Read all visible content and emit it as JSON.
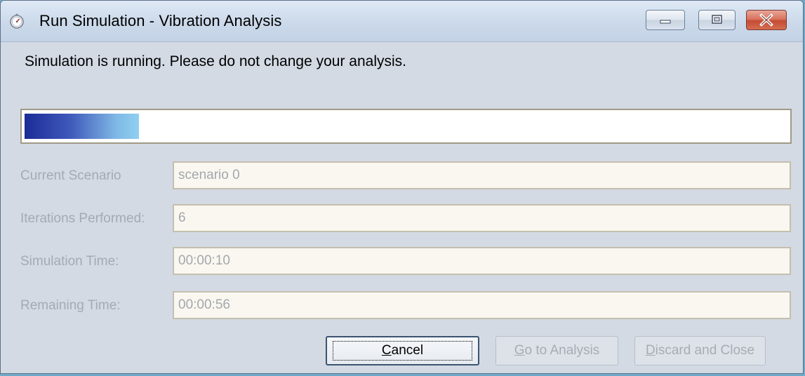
{
  "window": {
    "title": "Run Simulation - Vibration Analysis",
    "icon": "stopwatch-icon",
    "controls": {
      "minimize_icon": "minimize-icon",
      "maximize_icon": "maximize-icon",
      "close_icon": "close-icon"
    }
  },
  "status_message": "Simulation is running. Please do not change your analysis.",
  "progress": {
    "fraction": 0.15
  },
  "fields": [
    {
      "label": "Current Scenario",
      "value": "scenario 0"
    },
    {
      "label": "Iterations Performed:",
      "value": "6"
    },
    {
      "label": "Simulation Time:",
      "value": "00:00:10"
    },
    {
      "label": "Remaining Time:",
      "value": "00:00:56"
    }
  ],
  "buttons": {
    "cancel": {
      "label_underlined": "C",
      "label_rest": "ancel"
    },
    "go_to_analysis": {
      "label_underlined": "G",
      "label_rest": "o to Analysis"
    },
    "discard_and_close": {
      "label_underlined": "D",
      "label_rest": "iscard and Close"
    }
  },
  "colors": {
    "progress_start": "#1b2c97",
    "progress_end": "#8fd0ef",
    "disabled_text": "#a5aab2"
  }
}
